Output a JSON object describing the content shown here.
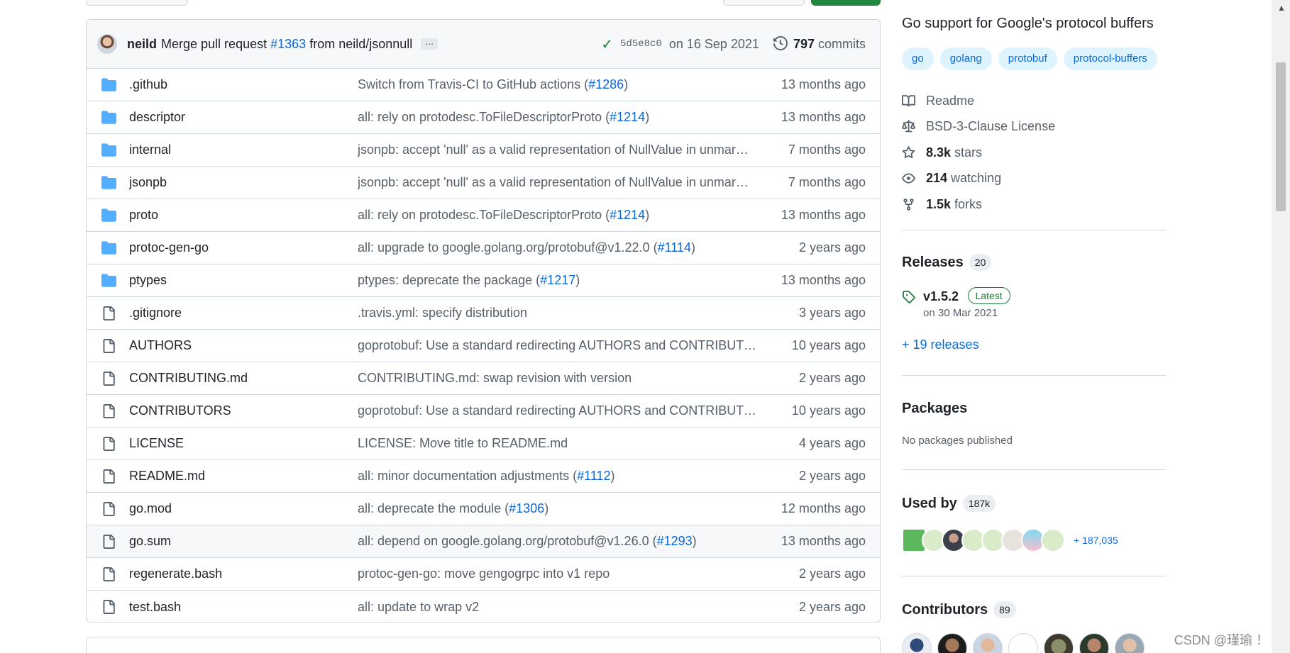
{
  "commit": {
    "author": "neild",
    "message_prefix": "Merge pull request",
    "pr": "#1363",
    "message_suffix": "from neild/jsonnull",
    "ellipsis": "…",
    "sha": "5d5e8c0",
    "date": "on 16 Sep 2021",
    "count": "797",
    "count_label": "commits"
  },
  "files": [
    {
      "type": "dir",
      "name": ".github",
      "msg": "Switch from Travis-CI to GitHub actions (",
      "link": "#1286",
      "msg_end": ")",
      "time": "13 months ago"
    },
    {
      "type": "dir",
      "name": "descriptor",
      "msg": "all: rely on protodesc.ToFileDescriptorProto (",
      "link": "#1214",
      "msg_end": ")",
      "time": "13 months ago"
    },
    {
      "type": "dir",
      "name": "internal",
      "msg": "jsonpb: accept 'null' as a valid representation of NullValue in unmar…",
      "link": "",
      "msg_end": "",
      "time": "7 months ago"
    },
    {
      "type": "dir",
      "name": "jsonpb",
      "msg": "jsonpb: accept 'null' as a valid representation of NullValue in unmar…",
      "link": "",
      "msg_end": "",
      "time": "7 months ago"
    },
    {
      "type": "dir",
      "name": "proto",
      "msg": "all: rely on protodesc.ToFileDescriptorProto (",
      "link": "#1214",
      "msg_end": ")",
      "time": "13 months ago"
    },
    {
      "type": "dir",
      "name": "protoc-gen-go",
      "msg": "all: upgrade to google.golang.org/protobuf@v1.22.0 (",
      "link": "#1114",
      "msg_end": ")",
      "time": "2 years ago"
    },
    {
      "type": "dir",
      "name": "ptypes",
      "msg": "ptypes: deprecate the package (",
      "link": "#1217",
      "msg_end": ")",
      "time": "13 months ago"
    },
    {
      "type": "file",
      "name": ".gitignore",
      "msg": ".travis.yml: specify distribution",
      "link": "",
      "msg_end": "",
      "time": "3 years ago"
    },
    {
      "type": "file",
      "name": "AUTHORS",
      "msg": "goprotobuf: Use a standard redirecting AUTHORS and CONTRIBUTORS f…",
      "link": "",
      "msg_end": "",
      "time": "10 years ago"
    },
    {
      "type": "file",
      "name": "CONTRIBUTING.md",
      "msg": "CONTRIBUTING.md: swap revision with version",
      "link": "",
      "msg_end": "",
      "time": "2 years ago"
    },
    {
      "type": "file",
      "name": "CONTRIBUTORS",
      "msg": "goprotobuf: Use a standard redirecting AUTHORS and CONTRIBUTORS f…",
      "link": "",
      "msg_end": "",
      "time": "10 years ago"
    },
    {
      "type": "file",
      "name": "LICENSE",
      "msg": "LICENSE: Move title to README.md",
      "link": "",
      "msg_end": "",
      "time": "4 years ago"
    },
    {
      "type": "file",
      "name": "README.md",
      "msg": "all: minor documentation adjustments (",
      "link": "#1112",
      "msg_end": ")",
      "time": "2 years ago"
    },
    {
      "type": "file",
      "name": "go.mod",
      "msg": "all: deprecate the module (",
      "link": "#1306",
      "msg_end": ")",
      "time": "12 months ago"
    },
    {
      "type": "file",
      "name": "go.sum",
      "msg": "all: depend on google.golang.org/protobuf@v1.26.0 (",
      "link": "#1293",
      "msg_end": ")",
      "time": "13 months ago"
    },
    {
      "type": "file",
      "name": "regenerate.bash",
      "msg": "protoc-gen-go: move gengogrpc into v1 repo",
      "link": "",
      "msg_end": "",
      "time": "2 years ago"
    },
    {
      "type": "file",
      "name": "test.bash",
      "msg": "all: update to wrap v2",
      "link": "",
      "msg_end": "",
      "time": "2 years ago"
    }
  ],
  "sidebar": {
    "about": "Go support for Google's protocol buffers",
    "topics": [
      "go",
      "golang",
      "protobuf",
      "protocol-buffers"
    ],
    "readme": "Readme",
    "license": "BSD-3-Clause License",
    "stars_count": "8.3k",
    "stars_label": "stars",
    "watching_count": "214",
    "watching_label": "watching",
    "forks_count": "1.5k",
    "forks_label": "forks",
    "releases_title": "Releases",
    "releases_count": "20",
    "release_version": "v1.5.2",
    "release_badge": "Latest",
    "release_date": "on 30 Mar 2021",
    "more_releases": "+ 19 releases",
    "packages_title": "Packages",
    "packages_empty": "No packages published",
    "usedby_title": "Used by",
    "usedby_count": "187k",
    "usedby_more": "+ 187,035",
    "contributors_title": "Contributors",
    "contributors_count": "89"
  },
  "watermark": "CSDN @瑾瑜 ！"
}
